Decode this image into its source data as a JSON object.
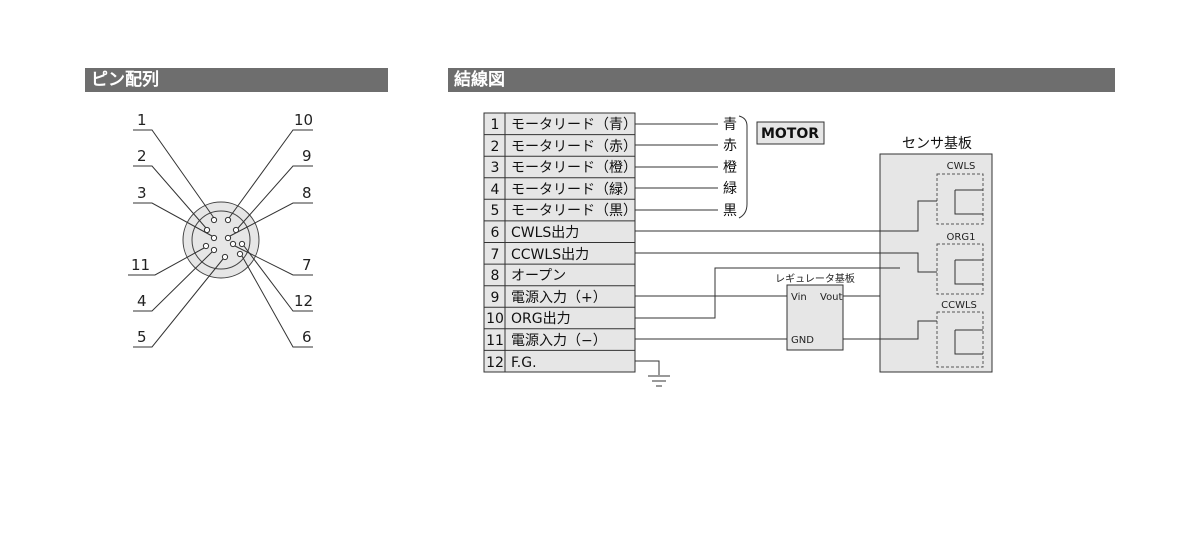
{
  "headers": {
    "pin_layout": "ピン配列",
    "wiring": "結線図"
  },
  "connector": {
    "labels": [
      {
        "id": "1",
        "text": "1"
      },
      {
        "id": "2",
        "text": "2"
      },
      {
        "id": "3",
        "text": "3"
      },
      {
        "id": "11",
        "text": "11"
      },
      {
        "id": "4",
        "text": "4"
      },
      {
        "id": "5",
        "text": "5"
      },
      {
        "id": "10",
        "text": "10"
      },
      {
        "id": "9",
        "text": "9"
      },
      {
        "id": "8",
        "text": "8"
      },
      {
        "id": "7",
        "text": "7"
      },
      {
        "id": "12",
        "text": "12"
      },
      {
        "id": "6",
        "text": "6"
      }
    ]
  },
  "pins": [
    {
      "num": "1",
      "label": "モータリード（青）"
    },
    {
      "num": "2",
      "label": "モータリード（赤）"
    },
    {
      "num": "3",
      "label": "モータリード（橙）"
    },
    {
      "num": "4",
      "label": "モータリード（緑）"
    },
    {
      "num": "5",
      "label": "モータリード（黒）"
    },
    {
      "num": "6",
      "label": "CWLS出力"
    },
    {
      "num": "7",
      "label": "CCWLS出力"
    },
    {
      "num": "8",
      "label": "オープン"
    },
    {
      "num": "9",
      "label": "電源入力（+）"
    },
    {
      "num": "10",
      "label": "ORG出力"
    },
    {
      "num": "11",
      "label": "電源入力（−）"
    },
    {
      "num": "12",
      "label": "F.G."
    }
  ],
  "wire_colors": [
    {
      "label": "青",
      "color": "#1f9bd6"
    },
    {
      "label": "赤",
      "color": "#d9302b"
    },
    {
      "label": "橙",
      "color": "#f08a1c"
    },
    {
      "label": "緑",
      "color": "#1f9a45"
    },
    {
      "label": "黒",
      "color": "#222222"
    }
  ],
  "motor": {
    "label": "MOTOR"
  },
  "regulator": {
    "title": "レギュレータ基板",
    "vin": "Vin",
    "vout": "Vout",
    "gnd": "GND"
  },
  "sensor": {
    "title": "センサ基板",
    "cwls": "CWLS",
    "org1": "ORG1",
    "ccwls": "CCWLS"
  }
}
